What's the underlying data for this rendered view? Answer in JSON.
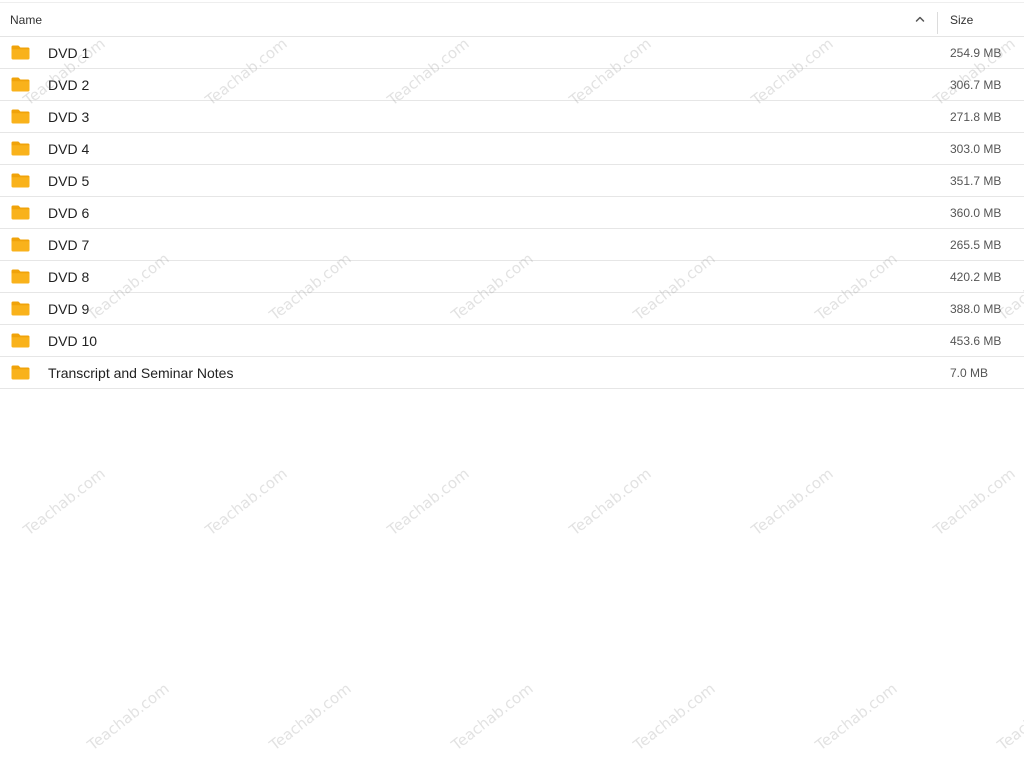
{
  "header": {
    "name_label": "Name",
    "size_label": "Size",
    "sort_icon": "chevron-up-icon"
  },
  "files": [
    {
      "name": "DVD 1",
      "size": "254.9 MB",
      "icon": "folder-icon"
    },
    {
      "name": "DVD 2",
      "size": "306.7 MB",
      "icon": "folder-icon"
    },
    {
      "name": "DVD 3",
      "size": "271.8 MB",
      "icon": "folder-icon"
    },
    {
      "name": "DVD 4",
      "size": "303.0 MB",
      "icon": "folder-icon"
    },
    {
      "name": "DVD 5",
      "size": "351.7 MB",
      "icon": "folder-icon"
    },
    {
      "name": "DVD 6",
      "size": "360.0 MB",
      "icon": "folder-icon"
    },
    {
      "name": "DVD 7",
      "size": "265.5 MB",
      "icon": "folder-icon"
    },
    {
      "name": "DVD 8",
      "size": "420.2 MB",
      "icon": "folder-icon"
    },
    {
      "name": "DVD 9",
      "size": "388.0 MB",
      "icon": "folder-icon"
    },
    {
      "name": "DVD 10",
      "size": "453.6 MB",
      "icon": "folder-icon"
    },
    {
      "name": "Transcript and Seminar Notes",
      "size": "7.0 MB",
      "icon": "folder-icon"
    }
  ],
  "colors": {
    "folder_body": "#F9B21B",
    "folder_tab": "#F0A30A"
  },
  "watermark": {
    "text": "Teachab.com"
  }
}
